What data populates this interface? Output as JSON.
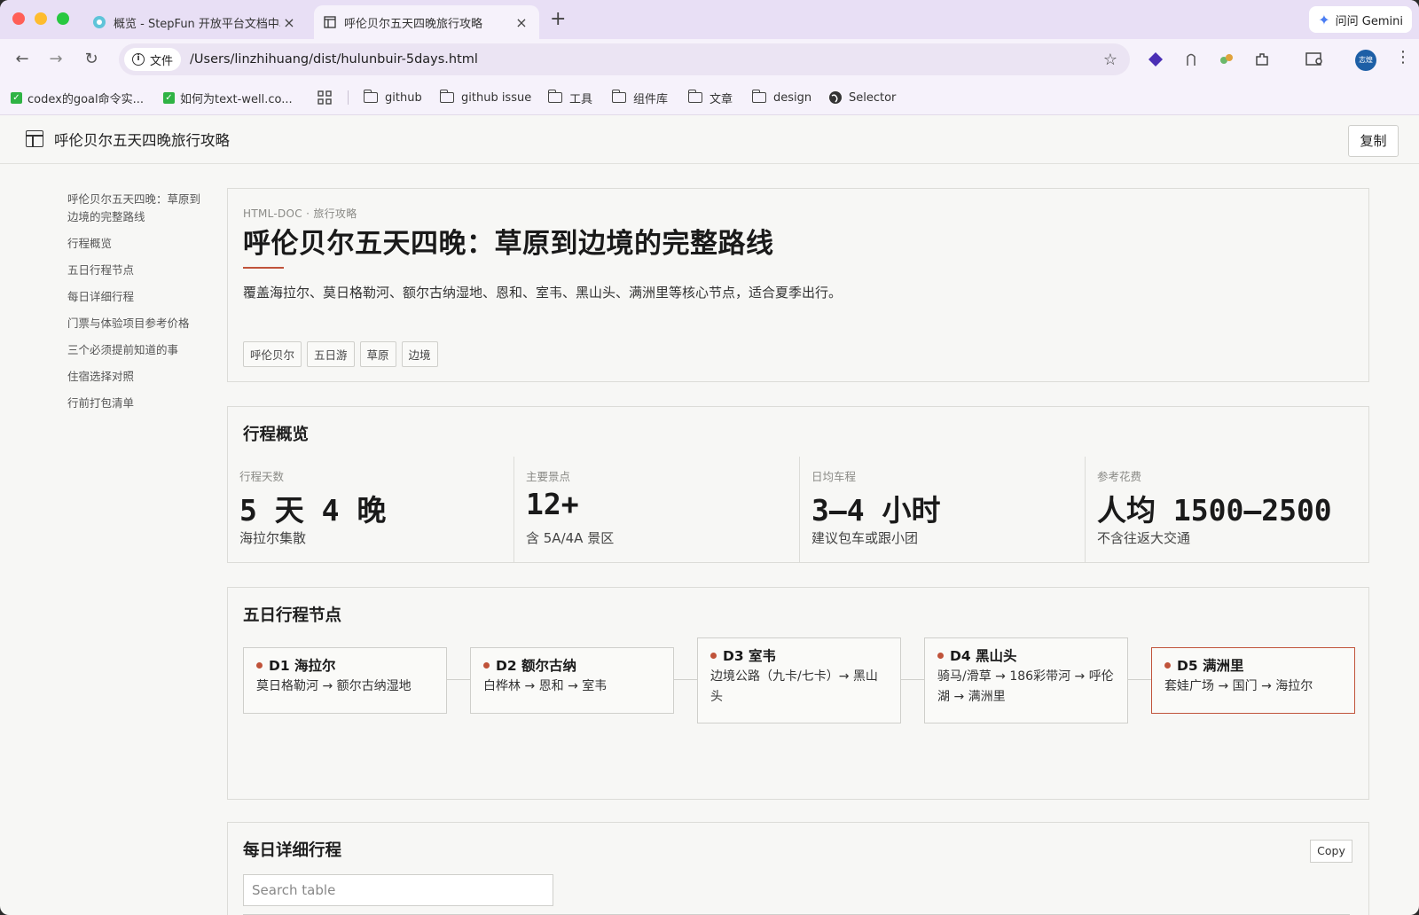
{
  "browser": {
    "tabs": [
      {
        "title": "概览 - StepFun 开放平台文档中心",
        "active": false
      },
      {
        "title": "呼伦贝尔五天四晚旅行攻略",
        "active": true
      }
    ],
    "gemini_label": "问问 Gemini",
    "chip_label": "文件",
    "url": "/Users/linzhihuang/dist/hulunbuir-5days.html",
    "avatar_text": "志煌",
    "bookmarks": [
      {
        "label": "codex的goal命令实...",
        "icon": "check-icon"
      },
      {
        "label": "如何为text-well.co...",
        "icon": "check-icon"
      },
      {
        "label": "github",
        "icon": "folder-icon"
      },
      {
        "label": "github issue",
        "icon": "folder-icon"
      },
      {
        "label": "工具",
        "icon": "folder-icon"
      },
      {
        "label": "组件库",
        "icon": "folder-icon"
      },
      {
        "label": "文章",
        "icon": "folder-icon"
      },
      {
        "label": "design",
        "icon": "folder-icon"
      },
      {
        "label": "Selector",
        "icon": "globe-icon"
      }
    ]
  },
  "page": {
    "header_title": "呼伦贝尔五天四晚旅行攻略",
    "copy_label": "复制",
    "toc": [
      "呼伦贝尔五天四晚：草原到边境的完整路线",
      "行程概览",
      "五日行程节点",
      "每日详细行程",
      "门票与体验项目参考价格",
      "三个必须提前知道的事",
      "住宿选择对照",
      "行前打包清单"
    ],
    "hero": {
      "meta": "HTML-DOC · 旅行攻略",
      "title": "呼伦贝尔五天四晚：草原到边境的完整路线",
      "lede": "覆盖海拉尔、莫日格勒河、额尔古纳湿地、恩和、室韦、黑山头、满洲里等核心节点，适合夏季出行。",
      "tags": [
        "呼伦贝尔",
        "五日游",
        "草原",
        "边境"
      ]
    },
    "overview": {
      "title": "行程概览",
      "stats": [
        {
          "label": "行程天数",
          "value": "5 天 4 晚",
          "note": "海拉尔集散"
        },
        {
          "label": "主要景点",
          "value": "12+",
          "note": "含 5A/4A 景区"
        },
        {
          "label": "日均车程",
          "value": "3–4 小时",
          "note": "建议包车或跟小团"
        },
        {
          "label": "参考花费",
          "value": "人均 1500–2500",
          "note": "不含往返大交通"
        }
      ]
    },
    "nodes": {
      "title": "五日行程节点",
      "items": [
        {
          "day": "D1 海拉尔",
          "route": "莫日格勒河 → 额尔古纳湿地"
        },
        {
          "day": "D2 额尔古纳",
          "route": "白桦林 → 恩和 → 室韦"
        },
        {
          "day": "D3 室韦",
          "route": "边境公路（九卡/七卡）→ 黑山头"
        },
        {
          "day": "D4 黑山头",
          "route": "骑马/滑草 → 186彩带河 → 呼伦湖 → 满洲里"
        },
        {
          "day": "D5 满洲里",
          "route": "套娃广场 → 国门 → 海拉尔"
        }
      ]
    },
    "daily": {
      "title": "每日详细行程",
      "copy_label": "Copy",
      "search_placeholder": "Search table"
    }
  },
  "colors": {
    "accent": "#c0533a",
    "tab_strip": "#e8dff5",
    "page_bg": "#f7f7f5"
  }
}
